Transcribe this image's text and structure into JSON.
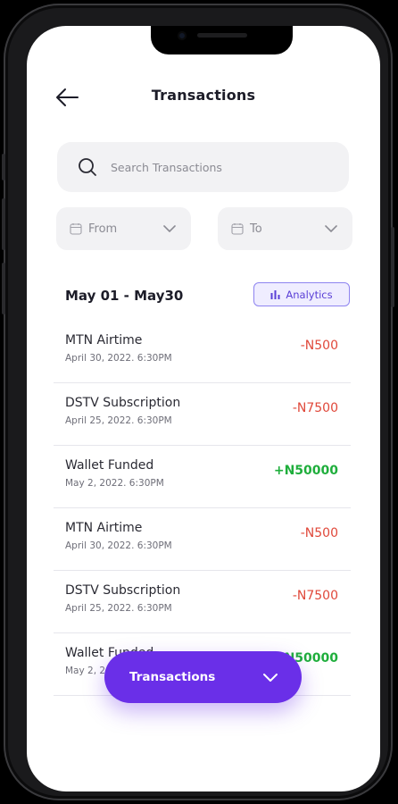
{
  "header": {
    "title": "Transactions"
  },
  "search": {
    "placeholder": "Search Transactions"
  },
  "filters": {
    "from_label": "From",
    "to_label": "To"
  },
  "period": {
    "label": "May 01 - May30",
    "analytics_label": "Analytics"
  },
  "transactions": [
    {
      "name": "MTN Airtime",
      "date": "April 30, 2022. 6:30PM",
      "amount": "-N500",
      "type": "debit"
    },
    {
      "name": "DSTV Subscription",
      "date": "April 25, 2022. 6:30PM",
      "amount": "-N7500",
      "type": "debit"
    },
    {
      "name": "Wallet Funded",
      "date": "May 2, 2022. 6:30PM",
      "amount": "+N50000",
      "type": "credit"
    },
    {
      "name": "MTN Airtime",
      "date": "April 30, 2022. 6:30PM",
      "amount": "-N500",
      "type": "debit"
    },
    {
      "name": "DSTV Subscription",
      "date": "April 25, 2022. 6:30PM",
      "amount": "-N7500",
      "type": "debit"
    },
    {
      "name": "Wallet Funded",
      "date": "May 2, 2022. 6:30PM",
      "amount": "+N50000",
      "type": "credit"
    }
  ],
  "fab": {
    "label": "Transactions"
  },
  "colors": {
    "accent": "#6a2fe8",
    "debit": "#e0483a",
    "credit": "#1fae3c"
  },
  "icons": {
    "back": "arrow-left-icon",
    "search": "search-icon",
    "calendar": "calendar-icon",
    "chevron": "chevron-down-icon",
    "analytics": "bar-chart-icon"
  }
}
